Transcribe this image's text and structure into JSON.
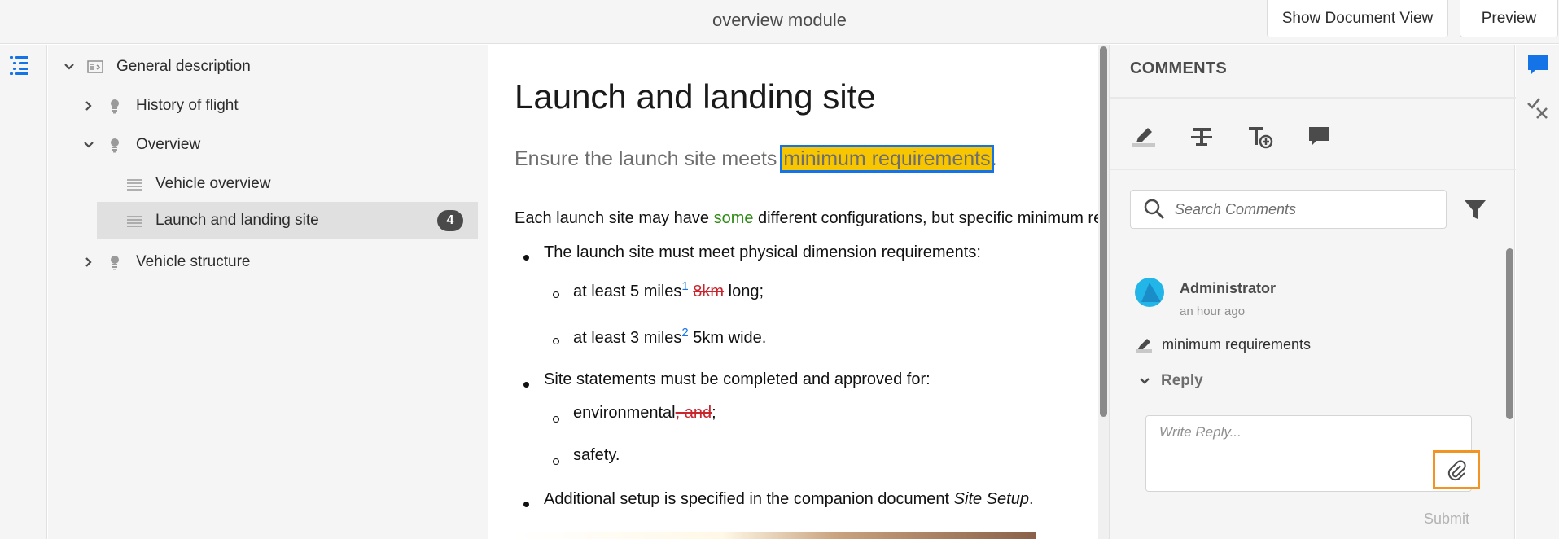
{
  "header": {
    "title": "overview module",
    "show_document_view": "Show Document View",
    "preview": "Preview"
  },
  "tree": {
    "items": [
      {
        "label": "General description",
        "expanded": true,
        "icon": "topic-map-icon"
      },
      {
        "label": "History of flight",
        "expanded": false,
        "icon": "lightbulb-icon"
      },
      {
        "label": "Overview",
        "expanded": true,
        "icon": "lightbulb-icon"
      },
      {
        "label": "Vehicle overview",
        "icon": "topic-icon"
      },
      {
        "label": "Launch and landing site",
        "icon": "topic-icon",
        "selected": true,
        "badge": "4"
      },
      {
        "label": "Vehicle structure",
        "expanded": false,
        "icon": "lightbulb-icon"
      }
    ]
  },
  "document": {
    "title": "Launch and landing site",
    "shortdesc_before": "Ensure the launch site meets ",
    "shortdesc_highlight": "minimum requirements",
    "shortdesc_after": ".",
    "para_before": "Each launch site may have ",
    "para_inserted": "some",
    "para_after": " different configurations, but specific minimum requirements apply.",
    "bullet1": "The launch site must meet physical dimension requirements:",
    "sub1_text": "at least 5 miles",
    "sub1_sup": "1",
    "sub1_del": "8km",
    "sub1_after": " long;",
    "sub2_text": "at least 3 miles",
    "sub2_sup": "2",
    "sub2_after": " 5km wide.",
    "bullet2": "Site statements must be completed and approved for:",
    "sub3_text": "environmental",
    "sub3_del": ", and",
    "sub3_after": ";",
    "sub4_text": "safety.",
    "bullet3_before": "Additional setup is specified in the companion document ",
    "bullet3_italic": "Site Setup",
    "bullet3_after": "."
  },
  "comments": {
    "header": "COMMENTS",
    "tools": [
      "highlight-icon",
      "strikethrough-icon",
      "insert-text-icon",
      "comment-icon"
    ],
    "search_placeholder": "Search Comments",
    "items": [
      {
        "author": "Administrator",
        "time": "an hour ago",
        "text": "minimum requirements",
        "reply_label": "Reply",
        "reply_placeholder": "Write Reply...",
        "submit": "Submit"
      }
    ]
  },
  "colors": {
    "accent": "#1473e6",
    "highlight": "#f7c600",
    "focus": "#f29423",
    "inserted": "#2d8a14",
    "deleted": "#c9252d"
  }
}
